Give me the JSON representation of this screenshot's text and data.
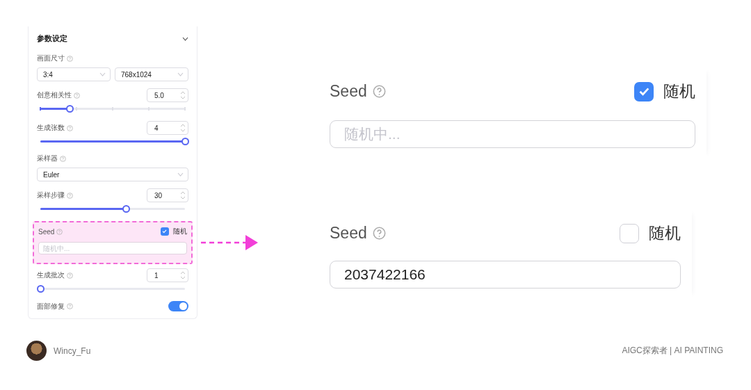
{
  "panel": {
    "title": "参数设定",
    "expanded": true,
    "fields": [
      {
        "kind": "select-pair",
        "label": "画面尺寸",
        "selects": [
          "3:4",
          "768x1024"
        ]
      },
      {
        "kind": "number-slider",
        "label": "创意相关性",
        "value": "5.0",
        "level": 0.2,
        "stepped": true
      },
      {
        "kind": "number-slider",
        "label": "生成张数",
        "value": "4",
        "level": 1,
        "stepped": false
      },
      {
        "kind": "select",
        "label": "采样器",
        "value": "Euler"
      },
      {
        "kind": "number-slider",
        "label": "采样步骤",
        "value": "30",
        "level": 0.59,
        "stepped": false
      },
      {
        "kind": "seed",
        "label": "Seed",
        "random_label": "随机",
        "checked": true,
        "placeholder": "随机中...",
        "highlighted": true
      },
      {
        "kind": "number-slider",
        "label": "生成批次",
        "value": "1",
        "level": 0,
        "stepped": false
      },
      {
        "kind": "toggle",
        "label": "面部修复",
        "on": true
      }
    ]
  },
  "seed_examples": [
    {
      "label": "Seed",
      "random_label": "随机",
      "checked": true,
      "placeholder": "随机中..."
    },
    {
      "label": "Seed",
      "random_label": "随机",
      "checked": false,
      "value": "2037422166"
    }
  ],
  "footer": {
    "author": "Wincy_Fu",
    "tagline": "AIGC探索者 | AI PAINTING"
  }
}
